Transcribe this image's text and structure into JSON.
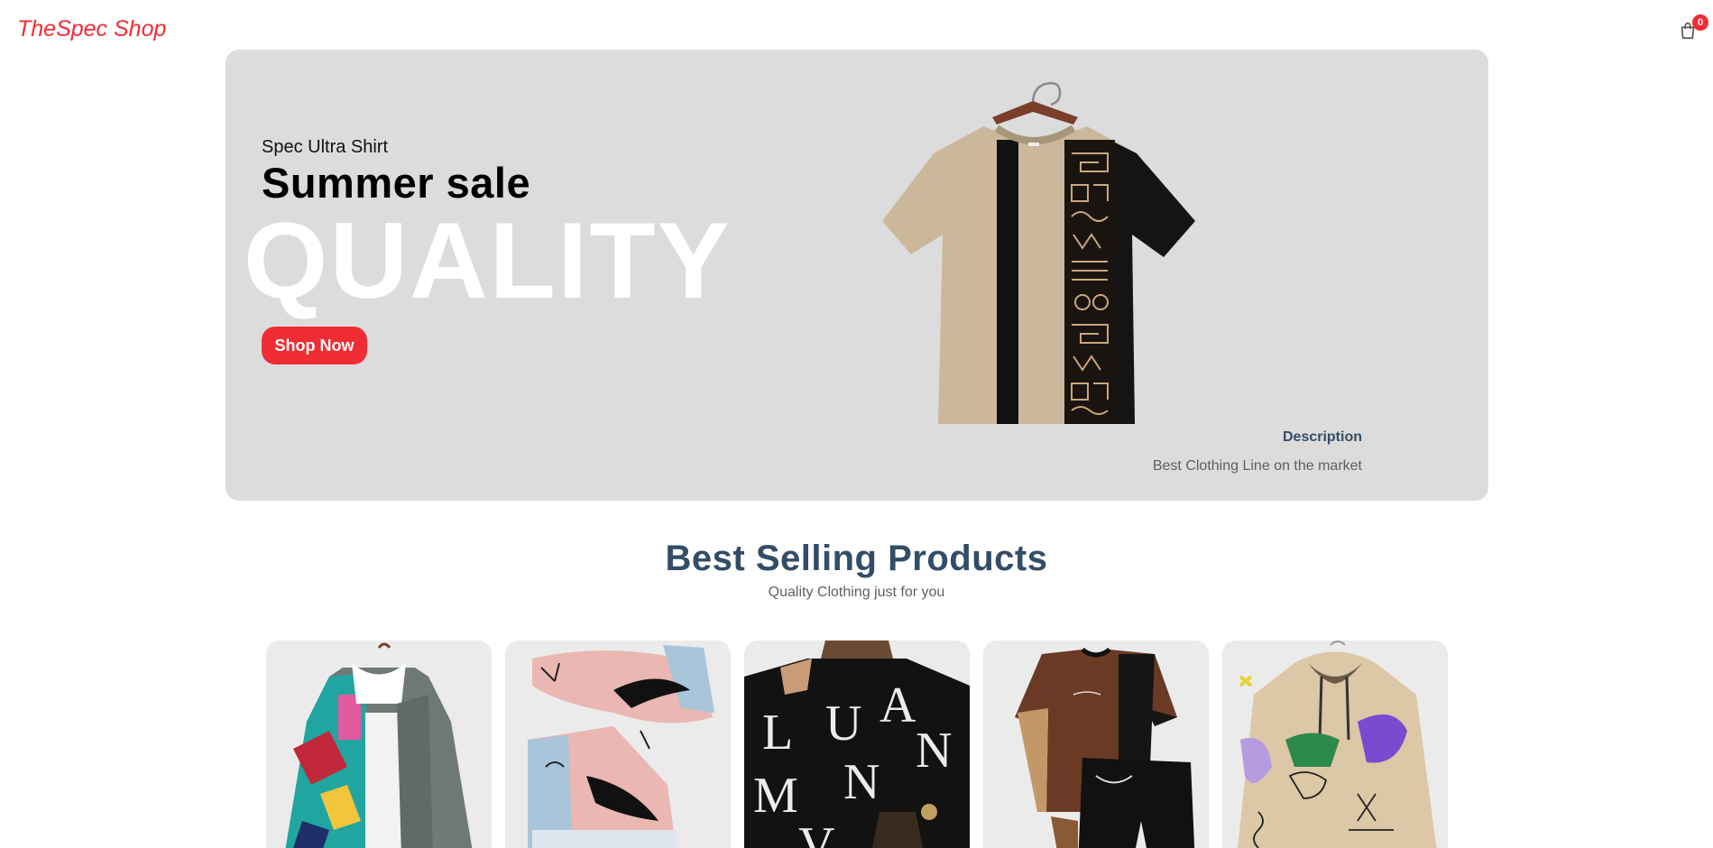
{
  "navbar": {
    "logo": "TheSpec Shop",
    "cart_count": "0",
    "cart_icon": "shopping-bag-icon"
  },
  "hero": {
    "small_text": "Spec Ultra Shirt",
    "mid_text": "Summer sale",
    "large_text": "QUALITY",
    "button_label": "Shop Now",
    "image_icon": "patterned-tshirt-image",
    "description_title": "Description",
    "description_text": "Best Clothing Line on the market"
  },
  "products": {
    "title": "Best Selling Products",
    "subtitle": "Quality Clothing just for you",
    "items": [
      {
        "image": "patchwork-jacket-image"
      },
      {
        "image": "graffiti-sneakers-image"
      },
      {
        "image": "letter-print-sweater-image"
      },
      {
        "image": "tshirt-shorts-set-image"
      },
      {
        "image": "graffiti-hoodie-image"
      }
    ]
  },
  "colors": {
    "accent": "#f02d34",
    "heading": "#324d67",
    "hero_bg": "#dcdcdc",
    "card_bg": "#ebebeb"
  }
}
